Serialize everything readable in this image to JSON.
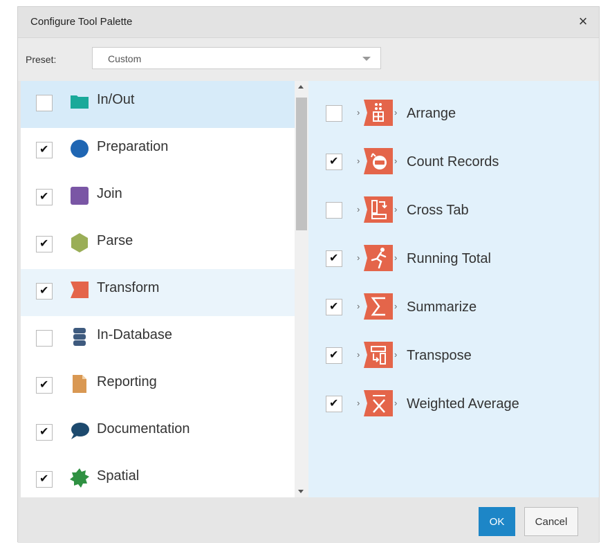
{
  "dialog": {
    "title": "Configure Tool Palette",
    "close_glyph": "×"
  },
  "preset": {
    "label": "Preset:",
    "value": "Custom"
  },
  "categories": [
    {
      "label": "In/Out",
      "checked": false,
      "icon": "folder-icon",
      "color": "#1aa99a"
    },
    {
      "label": "Preparation",
      "checked": true,
      "icon": "circle-icon",
      "color": "#1f66b3"
    },
    {
      "label": "Join",
      "checked": true,
      "icon": "square-icon",
      "color": "#7a56a5"
    },
    {
      "label": "Parse",
      "checked": true,
      "icon": "hexagon-icon",
      "color": "#9aae57"
    },
    {
      "label": "Transform",
      "checked": true,
      "icon": "ribbon-icon",
      "color": "#e4654a"
    },
    {
      "label": "In-Database",
      "checked": false,
      "icon": "database-icon",
      "color": "#3e5a7e"
    },
    {
      "label": "Reporting",
      "checked": true,
      "icon": "document-icon",
      "color": "#d99853"
    },
    {
      "label": "Documentation",
      "checked": true,
      "icon": "speech-bubble-icon",
      "color": "#1d4a6e"
    },
    {
      "label": "Spatial",
      "checked": true,
      "icon": "starburst-icon",
      "color": "#2f9142"
    }
  ],
  "tools": [
    {
      "label": "Arrange",
      "checked": false,
      "icon": "arrange-icon"
    },
    {
      "label": "Count Records",
      "checked": true,
      "icon": "count-records-icon"
    },
    {
      "label": "Cross Tab",
      "checked": false,
      "icon": "cross-tab-icon"
    },
    {
      "label": "Running Total",
      "checked": true,
      "icon": "running-total-icon"
    },
    {
      "label": "Summarize",
      "checked": true,
      "icon": "summarize-icon"
    },
    {
      "label": "Transpose",
      "checked": true,
      "icon": "transpose-icon"
    },
    {
      "label": "Weighted Average",
      "checked": true,
      "icon": "weighted-average-icon"
    }
  ],
  "tick_glyph": "✔",
  "footer": {
    "ok_label": "OK",
    "cancel_label": "Cancel"
  },
  "colors": {
    "accent": "#1d86c7",
    "tool_icon": "#e4654a",
    "selected_row": "#d7ebf9",
    "right_panel": "#e2f1fb"
  }
}
